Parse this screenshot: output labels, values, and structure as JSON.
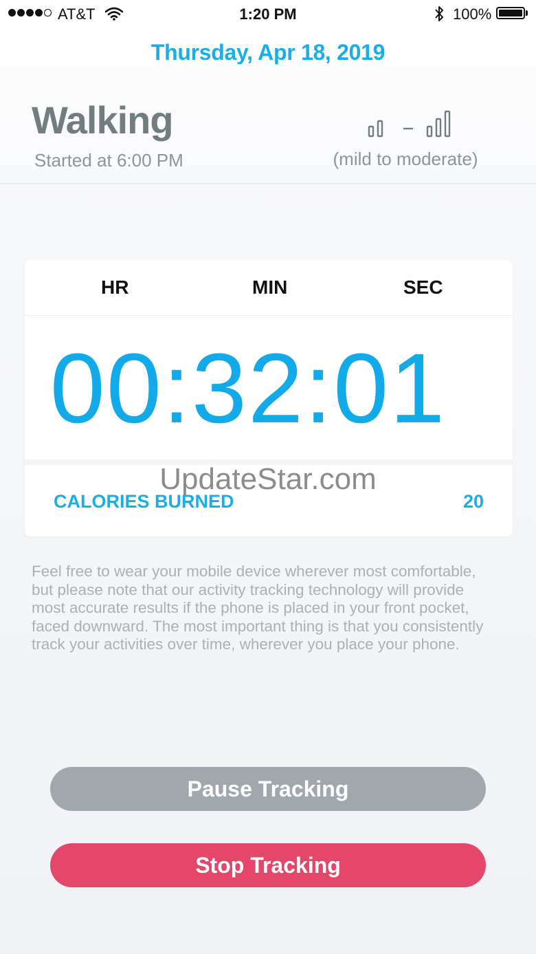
{
  "status_bar": {
    "carrier": "AT&T",
    "time": "1:20 PM",
    "battery": "100%",
    "signal_bars": 4,
    "icons": [
      "signal-dots-icon",
      "wifi-icon",
      "bluetooth-icon",
      "battery-icon"
    ]
  },
  "date": "Thursday, Apr 18, 2019",
  "activity": {
    "name": "Walking",
    "started": "Started at 6:00 PM",
    "intensity_separator": "–",
    "intensity_label": "(mild to moderate)",
    "intensity_icons": [
      "low-intensity-bars-icon",
      "high-intensity-bars-icon"
    ]
  },
  "timer": {
    "units": {
      "hr": "HR",
      "min": "MIN",
      "sec": "SEC"
    },
    "value": "00:32:01"
  },
  "calories": {
    "label": "CALORIES BURNED",
    "value": "20"
  },
  "watermark": "UpdateStar.com",
  "info_text": "Feel free to wear your mobile device wherever most comfortable,  but please note that our activity tracking technology will provide most accurate results if the phone is placed in your front pocket, faced downward.  The most important thing is that you consistently track your activities over time, wherever you place your phone.",
  "buttons": {
    "pause": "Pause Tracking",
    "stop": "Stop Tracking"
  },
  "colors": {
    "accent": "#1aaee6",
    "pause_button": "#a0a8ad",
    "stop_button": "#e4476a",
    "title": "#717d80"
  }
}
